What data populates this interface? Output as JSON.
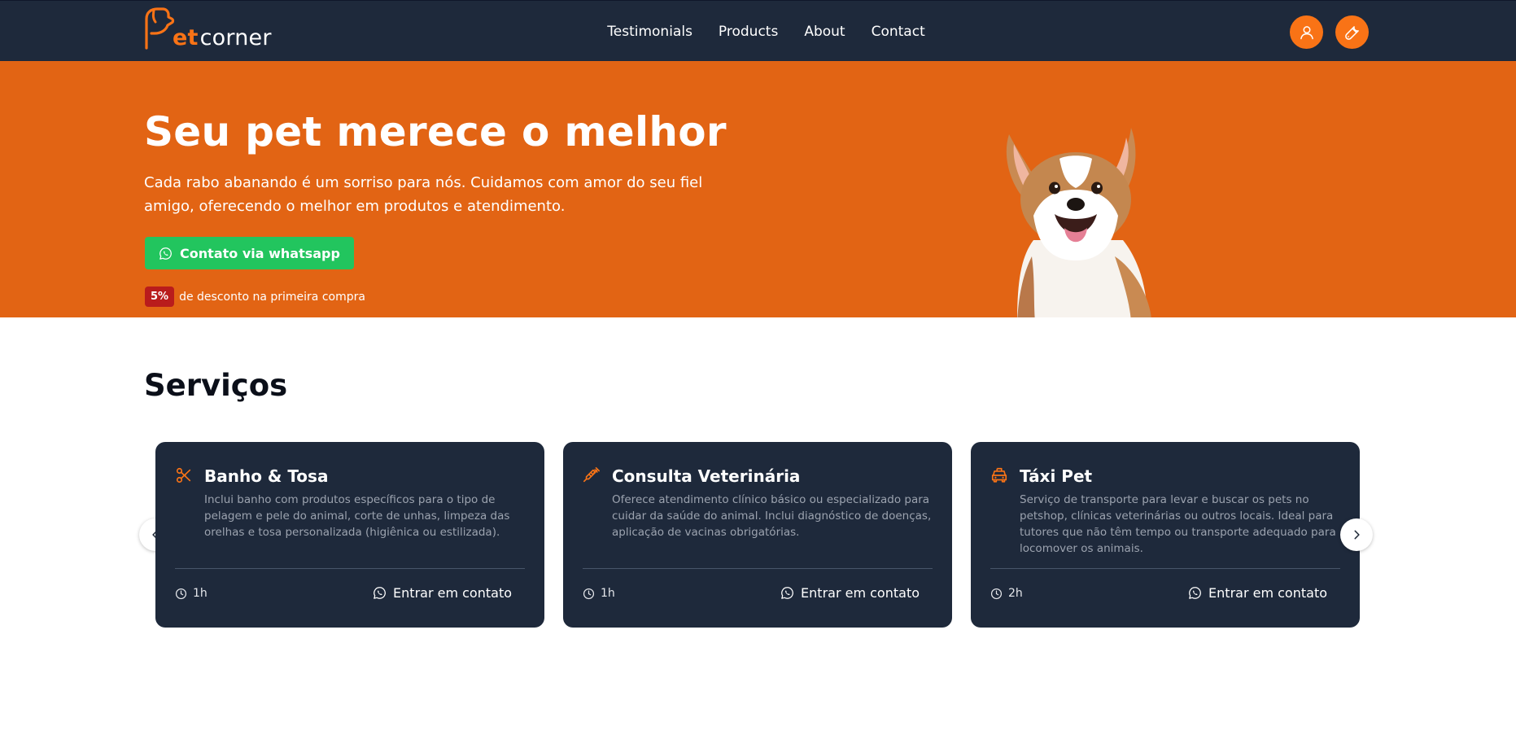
{
  "brand": {
    "logo_p": "P",
    "logo_et": "et",
    "logo_corner": "corner",
    "accent": "#f97316",
    "navy": "#1e293b"
  },
  "nav": {
    "items": [
      {
        "label": "Testimonials"
      },
      {
        "label": "Products"
      },
      {
        "label": "About"
      },
      {
        "label": "Contact"
      }
    ]
  },
  "header_actions": {
    "user_icon": "user-icon",
    "tool_icon": "wrench-icon"
  },
  "hero": {
    "title": "Seu pet merece o melhor",
    "subtitle": "Cada rabo abanando é um sorriso para nós. Cuidamos com amor do seu fiel amigo, oferecendo o melhor em produtos e atendimento.",
    "cta_label": "Contato via whatsapp",
    "discount_badge": "5%",
    "discount_text": "de desconto na primeira compra",
    "background": "#e26414"
  },
  "services": {
    "title": "Serviços",
    "cards": [
      {
        "icon": "scissors-icon",
        "title": "Banho & Tosa",
        "description": "Inclui banho com produtos específicos para o tipo de pelagem e pele do animal, corte de unhas, limpeza das orelhas e tosa personalizada (higiênica ou estilizada).",
        "duration": "1h",
        "contact_label": "Entrar em contato"
      },
      {
        "icon": "syringe-icon",
        "title": "Consulta Veterinária",
        "description": "Oferece atendimento clínico básico ou especializado para cuidar da saúde do animal. Inclui diagnóstico de doenças, aplicação de vacinas obrigatórias.",
        "duration": "1h",
        "contact_label": "Entrar em contato"
      },
      {
        "icon": "taxi-icon",
        "title": "Táxi Pet",
        "description": "Serviço de transporte para levar e buscar os pets no petshop, clínicas veterinárias ou outros locais. Ideal para tutores que não têm tempo ou transporte adequado para locomover os animais.",
        "duration": "2h",
        "contact_label": "Entrar em contato"
      }
    ]
  }
}
